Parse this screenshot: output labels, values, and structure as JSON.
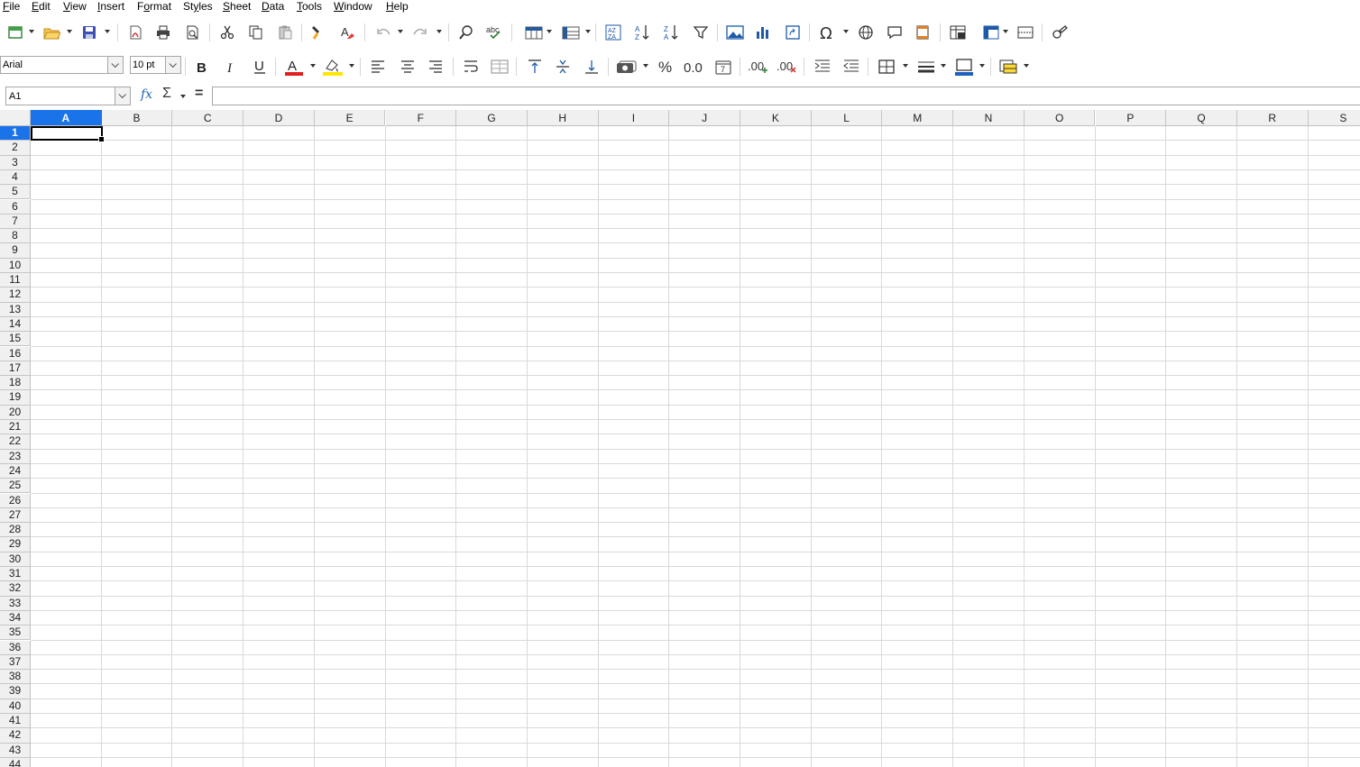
{
  "menu": [
    {
      "label": "File",
      "hotkey": "F",
      "rest": "ile"
    },
    {
      "label": "Edit",
      "hotkey": "E",
      "rest": "dit"
    },
    {
      "label": "View",
      "hotkey": "V",
      "rest": "iew"
    },
    {
      "label": "Insert",
      "hotkey": "I",
      "rest": "nsert"
    },
    {
      "label": "Format",
      "hotkey": "o",
      "pre": "F",
      "rest": "rmat"
    },
    {
      "label": "Styles",
      "hotkey": "y",
      "pre": "St",
      "rest": "les"
    },
    {
      "label": "Sheet",
      "hotkey": "S",
      "rest": "heet"
    },
    {
      "label": "Data",
      "hotkey": "D",
      "rest": "ata"
    },
    {
      "label": "Tools",
      "hotkey": "T",
      "rest": "ools"
    },
    {
      "label": "Window",
      "hotkey": "W",
      "rest": "indow"
    },
    {
      "label": "Help",
      "hotkey": "H",
      "rest": "elp"
    }
  ],
  "font": {
    "name": "Arial",
    "size": "10 pt"
  },
  "cell_ref": "A1",
  "formula": "",
  "colors": {
    "accent": "#1a73e8",
    "font_color_bar": "#e02020",
    "highlight_bar": "#ffe600",
    "border_color_bar": "#1f5fbf"
  },
  "columns": [
    "A",
    "B",
    "C",
    "D",
    "E",
    "F",
    "G",
    "H",
    "I",
    "J",
    "K",
    "L",
    "M",
    "N",
    "O",
    "P",
    "Q",
    "R",
    "S"
  ],
  "rows": [
    "1",
    "2",
    "3",
    "4",
    "5",
    "6",
    "7",
    "8",
    "9",
    "10",
    "11",
    "12",
    "13",
    "14",
    "15",
    "16",
    "17",
    "18",
    "19",
    "20",
    "21",
    "22",
    "23",
    "24",
    "25",
    "26",
    "27",
    "28",
    "29",
    "30",
    "31",
    "32",
    "33",
    "34",
    "35",
    "36",
    "37",
    "38",
    "39",
    "40",
    "41",
    "42",
    "43",
    "44"
  ],
  "selected_column": "A",
  "selected_row": "1",
  "toolbar_icons": {
    "row1": [
      "new-icon",
      "open-icon",
      "save-icon",
      "export-pdf-icon",
      "print-icon",
      "print-preview-icon",
      "cut-icon",
      "copy-icon",
      "paste-icon",
      "clone-formatting-icon",
      "clear-formatting-icon",
      "undo-icon",
      "redo-icon",
      "find-replace-icon",
      "spelling-icon",
      "row-icon",
      "column-icon",
      "sort-icon",
      "sort-ascending-icon",
      "sort-descending-icon",
      "autofilter-icon",
      "insert-image-icon",
      "insert-chart-icon",
      "pivot-table-icon",
      "special-character-icon",
      "hyperlink-icon",
      "comment-icon",
      "headers-footers-icon",
      "define-print-area-icon",
      "freeze-rows-columns-icon",
      "split-window-icon",
      "show-draw-functions-icon"
    ],
    "row2": [
      "bold-icon",
      "italic-icon",
      "underline-icon",
      "font-color-icon",
      "highlight-color-icon",
      "align-left-icon",
      "align-center-icon",
      "align-right-icon",
      "wrap-text-icon",
      "merge-cells-icon",
      "align-top-icon",
      "center-vertically-icon",
      "align-bottom-icon",
      "currency-format-icon",
      "percent-format-icon",
      "number-format-icon",
      "date-format-icon",
      "add-decimal-icon",
      "delete-decimal-icon",
      "increase-indent-icon",
      "decrease-indent-icon",
      "borders-icon",
      "border-style-icon",
      "border-color-icon",
      "conditional-format-icon"
    ]
  }
}
